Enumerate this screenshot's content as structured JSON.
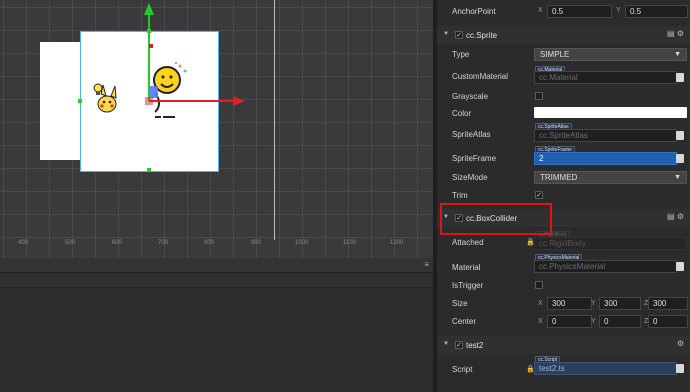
{
  "scene": {
    "ruler_labels": [
      "400",
      "500",
      "600",
      "700",
      "800",
      "900",
      "1000",
      "1100",
      "1200"
    ]
  },
  "inspector": {
    "anchor": {
      "label": "AnchorPoint",
      "x": "0.5",
      "y": "0.5",
      "x_axis": "X",
      "y_axis": "Y"
    },
    "sprite": {
      "title": "cc.Sprite",
      "type_label": "Type",
      "type_value": "SIMPLE",
      "custom_material_label": "CustomMaterial",
      "custom_material_tag": "cc.Material",
      "custom_material_value": "cc.Material",
      "grayscale_label": "Grayscale",
      "color_label": "Color",
      "sprite_atlas_label": "SpriteAtlas",
      "sprite_atlas_tag": "cc.SpriteAtlas",
      "sprite_atlas_value": "cc.SpriteAtlas",
      "sprite_frame_label": "SpriteFrame",
      "sprite_frame_tag": "cc.SpriteFrame",
      "sprite_frame_value": "2",
      "size_mode_label": "SizeMode",
      "size_mode_value": "TRIMMED",
      "trim_label": "Trim"
    },
    "box_collider": {
      "title": "cc.BoxCollider",
      "attached_label": "Attached",
      "attached_tag": "cc.RigidBody",
      "attached_value": "cc.RigidBody",
      "material_label": "Material",
      "material_tag": "cc.PhysicsMaterial",
      "material_value": "cc.PhysicsMaterial",
      "istrigger_label": "IsTrigger",
      "size_label": "Size",
      "size_x": "300",
      "size_y": "300",
      "size_z": "300",
      "center_label": "Center",
      "center_x": "0",
      "center_y": "0",
      "center_z": "0",
      "axis_x": "X",
      "axis_y": "Y",
      "axis_z": "Z"
    },
    "test2": {
      "title": "test2",
      "script_label": "Script",
      "script_tag": "cc.Script",
      "script_value": "test2.ts"
    }
  },
  "colors": {
    "accent_blue": "#1f5fb0",
    "highlight_red": "#e01414",
    "gizmo_green": "#22cc22",
    "gizmo_red": "#e02020"
  },
  "icons": [
    "grip-icon",
    "checkbox-icon",
    "lock-icon",
    "book-icon",
    "gear-icon",
    "menu-icon",
    "caret-down-icon",
    "collapse-arrow-icon"
  ]
}
